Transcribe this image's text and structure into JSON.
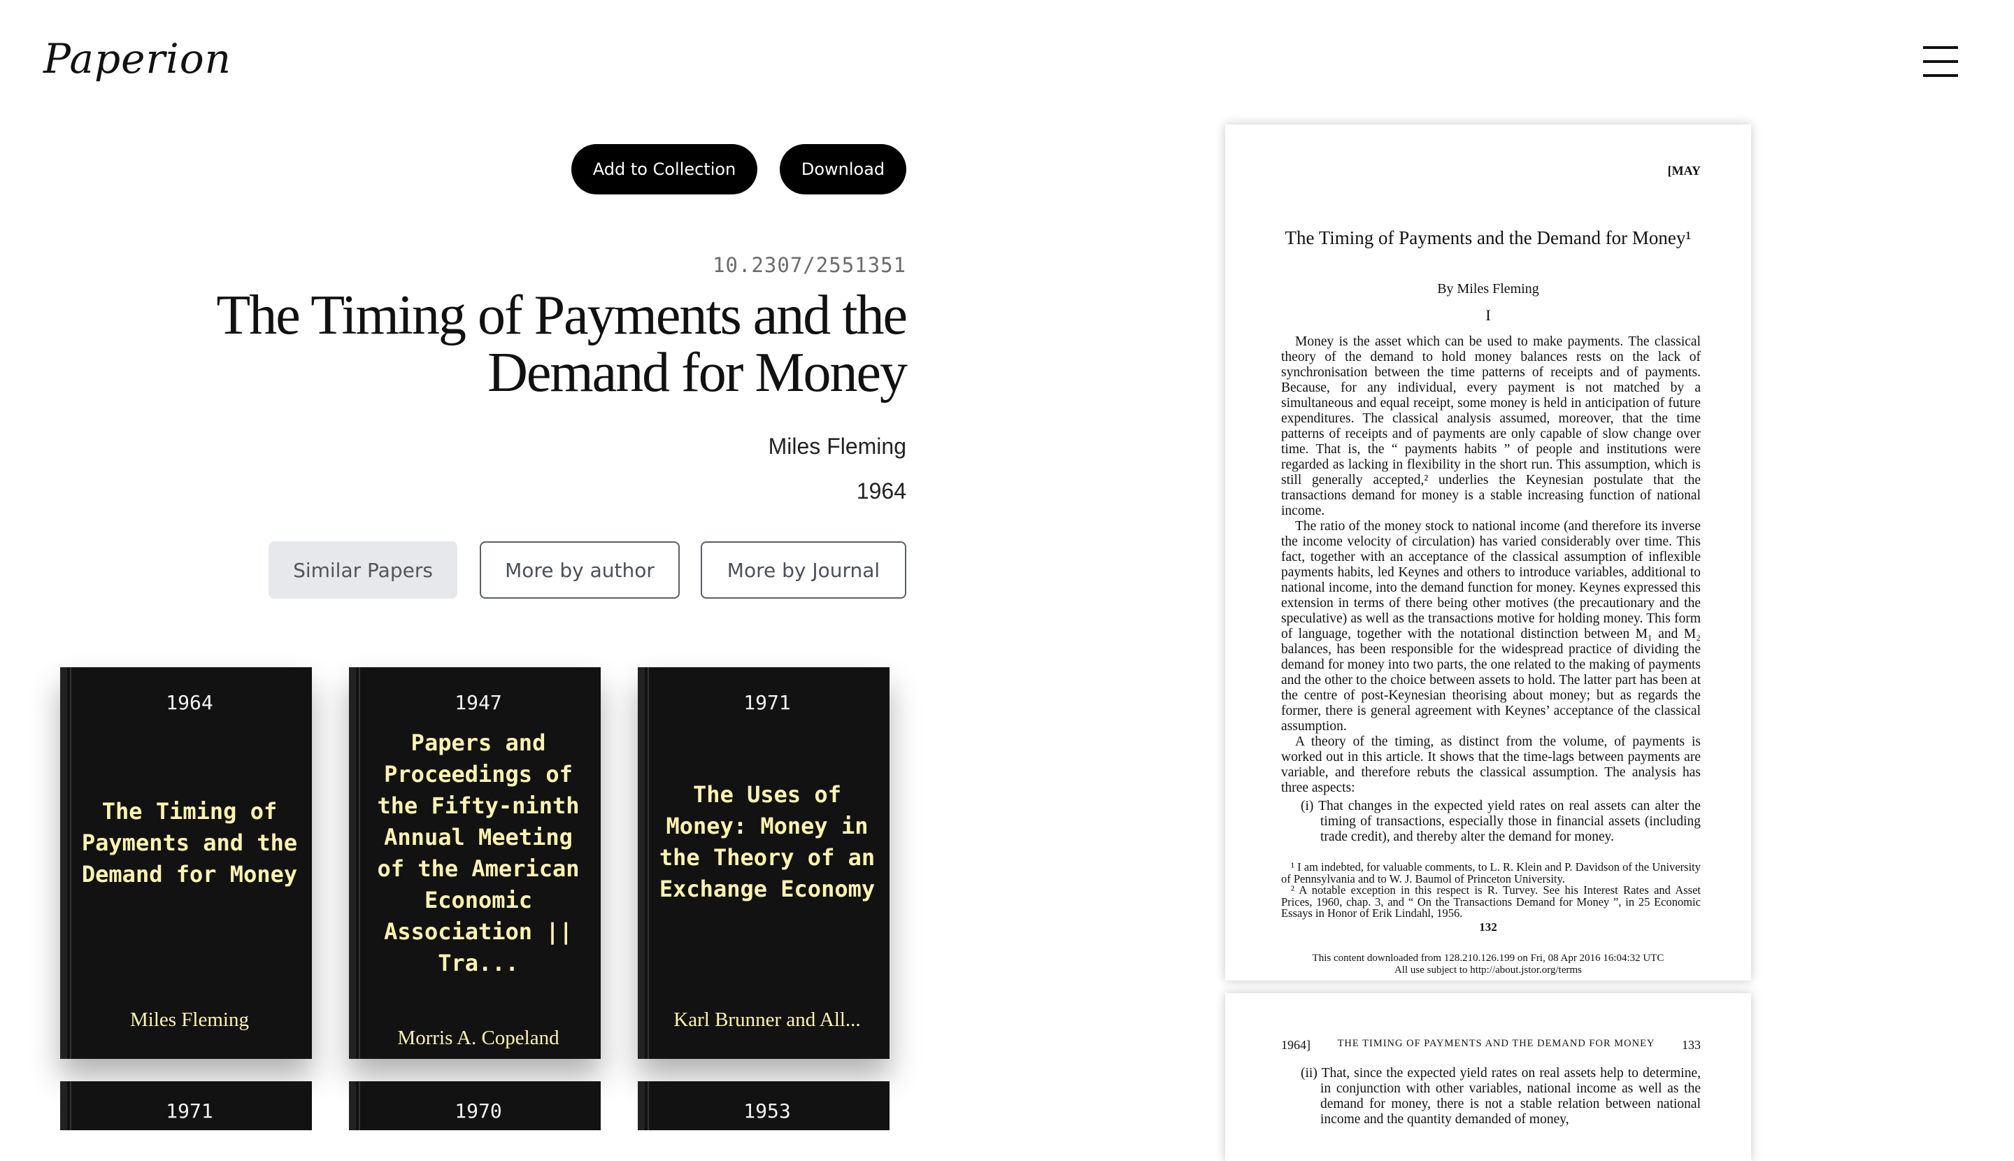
{
  "app": {
    "logo": "Paperion"
  },
  "header": {
    "menu_icon": "hamburger-icon"
  },
  "actions": {
    "add_to_collection": "Add to Collection",
    "download": "Download"
  },
  "paper": {
    "doi": "10.2307/2551351",
    "title": "The Timing of Payments and the Demand for Money",
    "author": "Miles Fleming",
    "year": "1964"
  },
  "tabs": [
    {
      "label": "Similar Papers",
      "active": true
    },
    {
      "label": "More by author",
      "active": false
    },
    {
      "label": "More by Journal",
      "active": false
    }
  ],
  "related": [
    {
      "year": "1964",
      "title": "The Timing of Payments and the Demand for Money",
      "author": "Miles Fleming"
    },
    {
      "year": "1947",
      "title": "Papers and Proceedings of the Fifty-ninth Annual Meeting of the American Economic Association || Tra...",
      "author": "Morris A. Copeland"
    },
    {
      "year": "1971",
      "title": "The Uses of Money: Money in the Theory of an Exchange Economy",
      "author": "Karl Brunner and All..."
    },
    {
      "year": "1971"
    },
    {
      "year": "1970"
    },
    {
      "year": "1953"
    }
  ],
  "preview": {
    "page1": {
      "running_head": "[MAY",
      "title": "The Timing of Payments and the Demand for Money¹",
      "byline": "By Miles Fleming",
      "section": "I",
      "para1": "Money is the asset which can be used to make payments. The classical theory of the demand to hold money balances rests on the lack of synchronisation between the time patterns of receipts and of payments. Because, for any individual, every payment is not matched by a simultaneous and equal receipt, some money is held in anticipation of future expenditures. The classical analysis assumed, moreover, that the time patterns of receipts and of payments are only capable of slow change over time. That is, the “ payments habits ” of people and institutions were regarded as lacking in flexibility in the short run. This assumption, which is still generally accepted,² underlies the Keynesian postulate that the transactions demand for money is a stable increasing function of national income.",
      "para2": "The ratio of the money stock to national income (and therefore its inverse the income velocity of circulation) has varied considerably over time. This fact, together with an acceptance of the classical assumption of inflexible payments habits, led Keynes and others to introduce variables, additional to national income, into the demand function for money. Keynes expressed this extension in terms of there being other motives (the precautionary and the speculative) as well as the transactions motive for holding money. This form of language, together with the notational distinction between M₁ and M₂ balances, has been responsible for the widespread practice of dividing the demand for money into two parts, the one related to the making of payments and the other to the choice between assets to hold. The latter part has been at the centre of post-Keynesian theorising about money; but as regards the former, there is general agreement with Keynes’ acceptance of the classical assumption.",
      "para3": "A theory of the timing, as distinct from the volume, of payments is worked out in this article. It shows that the time-lags between payments are variable, and therefore rebuts the classical assumption. The analysis has three aspects:",
      "item1": "(i) That changes in the expected yield rates on real assets can alter the timing of transactions, especially those in financial assets (including trade credit), and thereby alter the demand for money.",
      "footnote1": "¹ I am indebted, for valuable comments, to L. R. Klein and P. Davidson of the University of Pennsylvania and to W. J. Baumol of Princeton University.",
      "footnote2": "² A notable exception in this respect is R. Turvey. See his Interest Rates and Asset Prices, 1960, chap. 3, and “ On the Transactions Demand for Money ”, in 25 Economic Essays in Honor of Erik Lindahl, 1956.",
      "page_number": "132",
      "download_line1": "This content downloaded from 128.210.126.199 on Fri, 08 Apr 2016 16:04:32 UTC",
      "download_line2": "All use subject to http://about.jstor.org/terms"
    },
    "page2": {
      "head_left": "1964]",
      "head_title": "THE TIMING OF PAYMENTS AND THE DEMAND FOR MONEY",
      "head_right": "133",
      "item2": "(ii) That, since the expected yield rates on real assets help to determine, in conjunction with other variables, national income as well as the demand for money, there is not a stable relation between national income and the quantity demanded of money,"
    }
  }
}
